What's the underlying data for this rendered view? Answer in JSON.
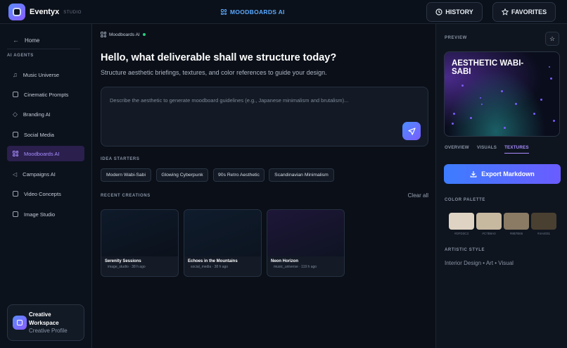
{
  "header": {
    "brand": "Eventyx",
    "brand_sub": "STUDIO",
    "center_title": "MOODBOARDS AI",
    "history": "HISTORY",
    "favorites": "FAVORITES"
  },
  "sidebar": {
    "home": "Home",
    "section": "AI AGENTS",
    "items": [
      {
        "label": "Music Universe",
        "icon": "music-icon"
      },
      {
        "label": "Cinematic Prompts",
        "icon": "video-icon"
      },
      {
        "label": "Branding AI",
        "icon": "diamond-icon"
      },
      {
        "label": "Social Media",
        "icon": "chat-icon"
      },
      {
        "label": "Moodboards AI",
        "icon": "grid-icon",
        "active": true
      },
      {
        "label": "Campaigns AI",
        "icon": "megaphone-icon"
      },
      {
        "label": "Video Concepts",
        "icon": "film-icon"
      },
      {
        "label": "Image Studio",
        "icon": "image-icon"
      }
    ],
    "workspace": {
      "title": "Creative Workspace",
      "subtitle": "Creative Profile"
    }
  },
  "main": {
    "breadcrumb": "Moodboards AI",
    "headline": "Hello, what deliverable shall we structure today?",
    "subline": "Structure aesthetic briefings, textures, and color references to guide your design.",
    "prompt_placeholder": "Describe the aesthetic to generate moodboard guidelines (e.g., Japanese minimalism and brutalism)...",
    "ideas_label": "IDEA STARTERS",
    "chips": [
      "Modern Wabi-Sabi",
      "Glowing Cyberpunk",
      "90s Retro Aesthetic",
      "Scandinavian Minimalism"
    ],
    "recent_label": "RECENT CREATIONS",
    "clear_all": "Clear all",
    "cards": [
      {
        "title": "Serenity Sessions",
        "meta": "image_studio · 38 h ago"
      },
      {
        "title": "Echoes in the Mountains",
        "meta": "social_media · 38 h ago"
      },
      {
        "title": "Neon Horizon",
        "meta": "music_universe · 119 h ago"
      }
    ]
  },
  "panel": {
    "preview_label": "PREVIEW",
    "preview_title": "AESTHETIC WABI-SABI",
    "tabs": [
      "OVERVIEW",
      "VISUALS",
      "TEXTURES"
    ],
    "active_tab": "TEXTURES",
    "export": "Export Markdown",
    "palette_label": "COLOR PALETTE",
    "palette": [
      "#DFD3C3",
      "#C7B8A0",
      "#8B7B65",
      "#4A4031"
    ],
    "style_label": "ARTISTIC STYLE",
    "style_text": "Interior Design • Art • Visual"
  },
  "colors": {
    "accent": "#7A5CFF",
    "link": "#5AA9FF",
    "online": "#27D17F"
  }
}
